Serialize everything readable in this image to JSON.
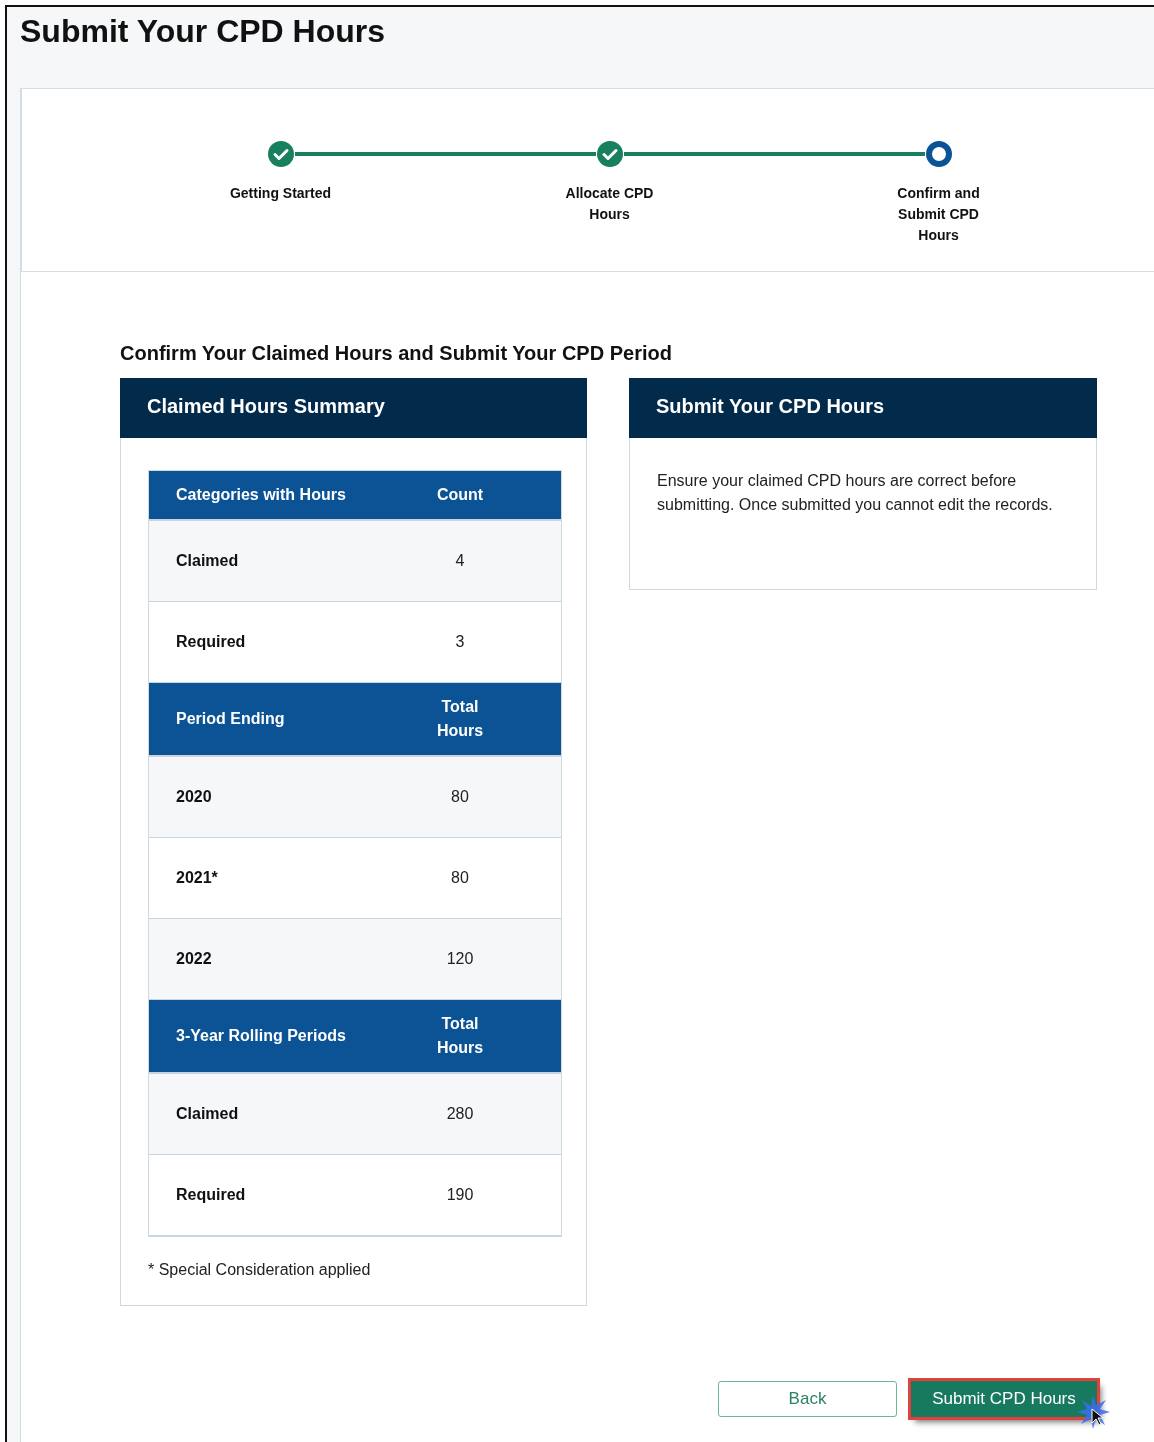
{
  "page_title": "Submit Your CPD Hours",
  "steps": [
    {
      "label": "Getting Started",
      "completed": true,
      "selected": false
    },
    {
      "label": "Allocate CPD Hours",
      "completed": true,
      "selected": false
    },
    {
      "label": "Confirm and Submit CPD Hours",
      "completed": false,
      "selected": true
    }
  ],
  "heading": "Confirm Your Claimed Hours and Submit Your CPD Period",
  "summary": {
    "title": "Claimed Hours Summary",
    "sections": [
      {
        "columns": [
          "Categories with Hours",
          "Count"
        ],
        "rows": [
          [
            "Claimed",
            "4"
          ],
          [
            "Required",
            "3"
          ]
        ]
      },
      {
        "columns": [
          "Period Ending",
          "Total Hours"
        ],
        "rows": [
          [
            "2020",
            "80"
          ],
          [
            "2021*",
            "80"
          ],
          [
            "2022",
            "120"
          ]
        ]
      },
      {
        "columns": [
          "3-Year Rolling Periods",
          "Total Hours"
        ],
        "rows": [
          [
            "Claimed",
            "280"
          ],
          [
            "Required",
            "190"
          ]
        ]
      }
    ],
    "footnote": "* Special Consideration applied"
  },
  "submit_panel": {
    "title": "Submit Your CPD Hours",
    "text": "Ensure your claimed CPD hours are correct before submitting. Once submitted you cannot edit the records."
  },
  "buttons": [
    {
      "label": "Back",
      "kind": "secondary",
      "highlighted": false
    },
    {
      "label": "Submit CPD Hours",
      "kind": "primary",
      "highlighted": true
    }
  ]
}
